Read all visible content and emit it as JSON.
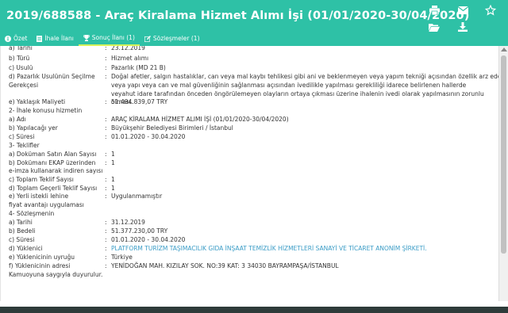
{
  "header": {
    "title": "2019/688588 - Araç Kiralama Hizmet Alımı İşi (01/01/2020-30/04/2020)",
    "icons": [
      "print-icon",
      "mail-icon",
      "star-icon",
      "folder-open-icon",
      "download-icon"
    ]
  },
  "tabs": [
    {
      "label": "Özet",
      "icon": "info-icon"
    },
    {
      "label": "İhale İlanı",
      "icon": "document-icon"
    },
    {
      "label": "Sonuç İlanı (1)",
      "icon": "trophy-icon",
      "active": true
    },
    {
      "label": "Sözleşmeler (1)",
      "icon": "edit-icon"
    }
  ],
  "details": {
    "a_tarihi": {
      "label": "a) Tarihi",
      "value": "23.12.2019"
    },
    "b_turu": {
      "label": "b) Türü",
      "value": "Hizmet alımı"
    },
    "c_usulu": {
      "label": "c) Usulü",
      "value": "Pazarlık (MD 21 B)"
    },
    "d_gerekce": {
      "label_line1": "d) Pazarlık Usulünün Seçilme",
      "label_line2": "Gerekçesi",
      "value_line1": "Doğal afetler, salgın hastalıklar, can veya mal kaybı tehlikesi gibi ani ve beklenmeyen veya yapım tekniği açısından özellik arz eden ",
      "value_rest": "veya yapı veya can ve mal güvenliğinin sağlanması açısından ivedilikle yapılması gerekliliği idarece belirlenen hallerde veyahut idare tarafından önceden öngörülemeyen olayların ortaya çıkması üzerine ihalenin ivedi olarak yapılmasının zorunlu olması."
    },
    "e_maliyet": {
      "label": "e) Yaklaşık Maliyeti",
      "value": "51.494.839,07 TRY"
    }
  },
  "section2": {
    "heading": "2- İhale konusu hizmetin",
    "a_adi": {
      "label": "a) Adı",
      "value": "ARAÇ KİRALAMA HİZMET ALIMI İŞİ (01/01/2020-30/04/2020)"
    },
    "b_yer": {
      "label": "b) Yapılacağı yer",
      "value": "Büyükşehir Belediyesi Birimleri / İstanbul"
    },
    "c_suresi": {
      "label": "c) Süresi",
      "value": "01.01.2020 - 30.04.2020"
    }
  },
  "section3": {
    "heading": "3- Teklifler",
    "a": {
      "label": "a) Doküman Satın Alan Sayısı",
      "value": "1"
    },
    "b": {
      "label_line1": "b) Dokümanı EKAP üzerinden",
      "label_line2": "e-imza kullanarak indiren sayısı",
      "value": "1"
    },
    "c": {
      "label": "c) Toplam Teklif Sayısı",
      "value": "1"
    },
    "d": {
      "label": "d) Toplam Geçerli Teklif Sayısı",
      "value": "1"
    },
    "e": {
      "label_line1": "e) Yerli istekli lehine",
      "label_line2": "fiyat avantajı uygulaması",
      "value": "Uygulanmamıştır"
    }
  },
  "section4": {
    "heading": "4- Sözleşmenin",
    "a": {
      "label": "a) Tarihi",
      "value": "31.12.2019"
    },
    "b": {
      "label": "b) Bedeli",
      "value": "51.377.230,00 TRY"
    },
    "c": {
      "label": "c) Süresi",
      "value": "01.01.2020 - 30.04.2020"
    },
    "d": {
      "label": "d) Yüklenici",
      "value": "PLATFORM TURİZM TAŞIMACILIK GIDA İNŞAAT TEMİZLİK HİZMETLERİ SANAYİ VE TİCARET ANONİM ŞİRKETİ."
    },
    "e": {
      "label": "e) Yüklenicinin uyruğu",
      "value": "Türkiye"
    },
    "f": {
      "label": "f) Yüklenicinin adresi",
      "value": "YENİDOĞAN MAH. KIZILAY SOK. NO:39 KAT: 3 34030 BAYRAMPAŞA/İSTANBUL"
    }
  },
  "closing": "Kamuoyuna saygıyla duyurulur.",
  "colors": {
    "header_bg": "#2ec1a6",
    "active_tab_underline": "#d7f25a",
    "link": "#3a9cc6"
  }
}
